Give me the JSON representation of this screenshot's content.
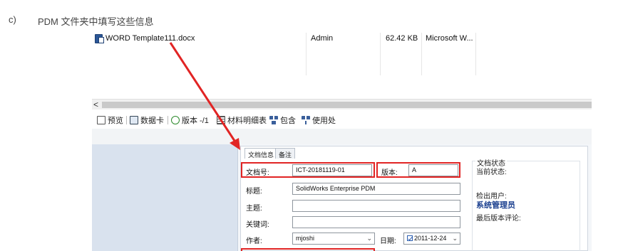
{
  "doc": {
    "marker": "c)",
    "instruction": "PDM 文件夹中填写这些信息"
  },
  "file": {
    "name": "WORD Template111.docx",
    "author": "Admin",
    "size": "62.42 KB",
    "type": "Microsoft W..."
  },
  "scrollbar": {
    "left_arrow": "<"
  },
  "tabs": [
    {
      "label": "预览",
      "icon": "preview-icon"
    },
    {
      "label": "数据卡",
      "icon": "datacard-icon"
    },
    {
      "label": "版本 -/1",
      "icon": "version-icon"
    },
    {
      "label": "材料明细表",
      "icon": "bom-icon"
    },
    {
      "label": "包含",
      "icon": "contains-icon"
    },
    {
      "label": "使用处",
      "icon": "used-by-icon"
    }
  ],
  "form": {
    "tabs": [
      "文档信息",
      "备注"
    ],
    "doc_no_label": "文档号:",
    "doc_no_value": "ICT-20181119-01",
    "version_label": "版本:",
    "version_value": "A",
    "title_label": "标题:",
    "title_value": "SolidWorks Enterprise PDM",
    "subject_label": "主题:",
    "subject_value": "",
    "keywords_label": "关键词:",
    "keywords_value": "",
    "author_label": "作者:",
    "author_value": "mjoshi",
    "date_label": "日期:",
    "date_value": "2011-12-24"
  },
  "status": {
    "group_title": "文档状态",
    "current_state_label": "当前状态:",
    "checked_out_by_label": "检出用户:",
    "checked_out_by_value": "系统管理员",
    "last_version_comment_label": "最后版本评论:"
  },
  "colors": {
    "annotation_red": "#e12424",
    "panel_blue": "#d9e2ee",
    "strong_text": "#1a3f8f"
  }
}
